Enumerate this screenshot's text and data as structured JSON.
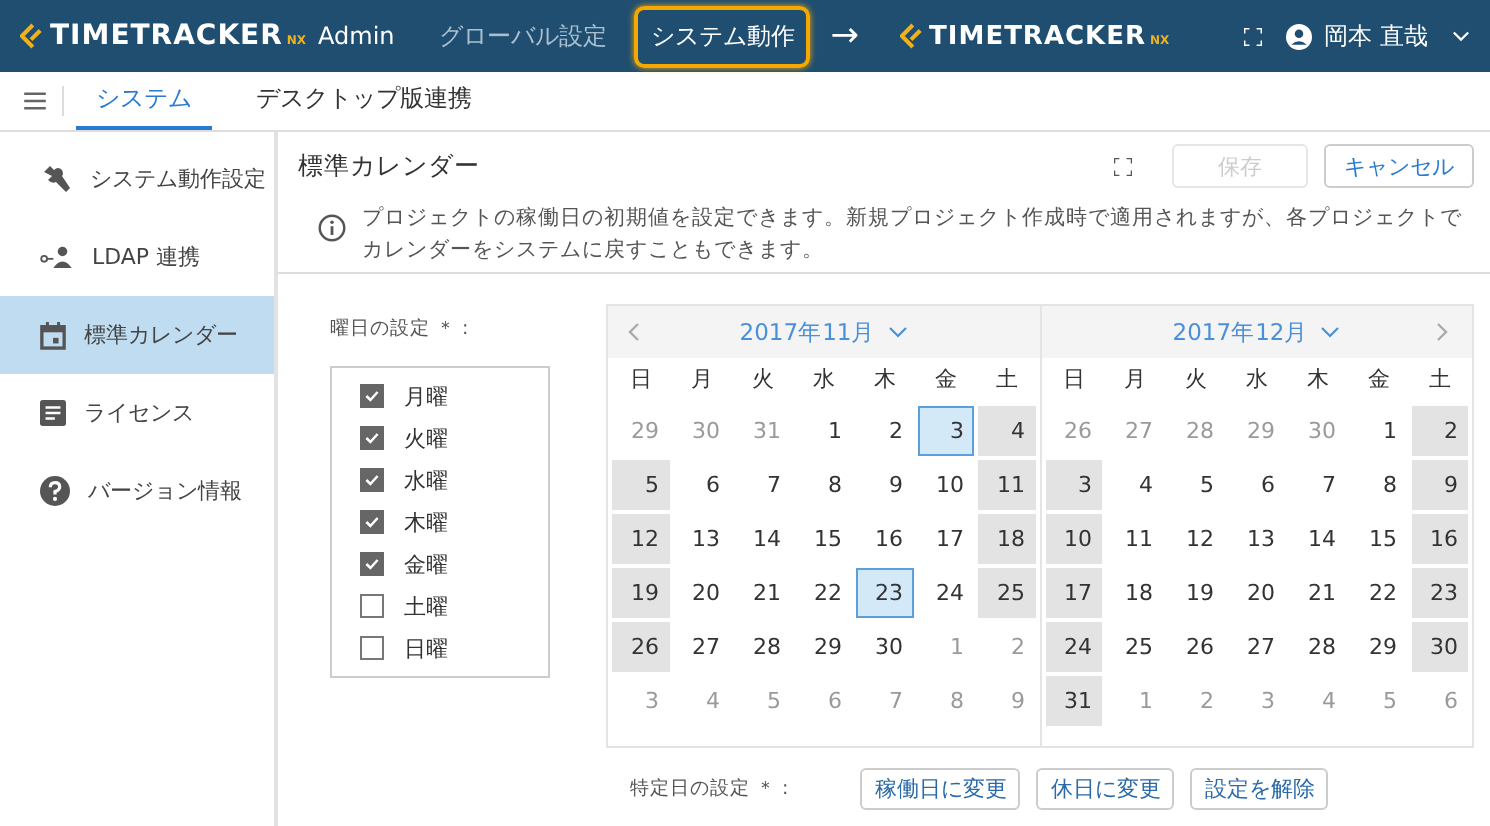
{
  "header": {
    "logo": {
      "name": "TIMETRACKER",
      "suffix": "NX",
      "product": "Admin"
    },
    "nav": [
      {
        "label": "グローバル設定",
        "selected": false
      },
      {
        "label": "システム動作",
        "selected": true
      }
    ],
    "arrow": "→",
    "target_logo": {
      "name": "TIMETRACKER",
      "suffix": "NX"
    },
    "user": "岡本 直哉"
  },
  "tabs": [
    {
      "label": "システム",
      "selected": true
    },
    {
      "label": "デスクトップ版連携",
      "selected": false
    }
  ],
  "sidebar": {
    "items": [
      {
        "kind": "wrench",
        "label": "システム動作設定",
        "selected": false
      },
      {
        "kind": "ldap",
        "label": "LDAP 連携",
        "selected": false
      },
      {
        "kind": "calendar",
        "label": "標準カレンダー",
        "selected": true
      },
      {
        "kind": "license",
        "label": "ライセンス",
        "selected": false
      },
      {
        "kind": "help",
        "label": "バージョン情報",
        "selected": false
      }
    ]
  },
  "panel": {
    "title": "標準カレンダー",
    "buttons": [
      {
        "label": "保存",
        "disabled": true
      },
      {
        "label": "キャンセル",
        "disabled": false
      }
    ],
    "info": "プロジェクトの稼働日の初期値を設定できます。新規プロジェクト作成時で適用されますが、各プロジェクトでカレンダーをシステムに戻すこともできます。",
    "weekday_label": "曜日の設定 ＊ :",
    "weekdays": [
      {
        "label": "月曜",
        "checked": true
      },
      {
        "label": "火曜",
        "checked": true
      },
      {
        "label": "水曜",
        "checked": true
      },
      {
        "label": "木曜",
        "checked": true
      },
      {
        "label": "金曜",
        "checked": true
      },
      {
        "label": "土曜",
        "checked": false
      },
      {
        "label": "日曜",
        "checked": false
      }
    ],
    "months": [
      {
        "title": "2017年11月",
        "prev": true,
        "next": false,
        "day_names": [
          "日",
          "月",
          "火",
          "水",
          "木",
          "金",
          "土"
        ],
        "weeks": [
          [
            {
              "d": "29",
              "outside": true,
              "holiday": false,
              "selected": false
            },
            {
              "d": "30",
              "outside": true,
              "holiday": false,
              "selected": false
            },
            {
              "d": "31",
              "outside": true,
              "holiday": false,
              "selected": false
            },
            {
              "d": "1",
              "outside": false,
              "holiday": false,
              "selected": false
            },
            {
              "d": "2",
              "outside": false,
              "holiday": false,
              "selected": false
            },
            {
              "d": "3",
              "outside": false,
              "holiday": false,
              "selected": true
            },
            {
              "d": "4",
              "outside": false,
              "holiday": true,
              "selected": false
            }
          ],
          [
            {
              "d": "5",
              "outside": false,
              "holiday": true,
              "selected": false
            },
            {
              "d": "6",
              "outside": false,
              "holiday": false,
              "selected": false
            },
            {
              "d": "7",
              "outside": false,
              "holiday": false,
              "selected": false
            },
            {
              "d": "8",
              "outside": false,
              "holiday": false,
              "selected": false
            },
            {
              "d": "9",
              "outside": false,
              "holiday": false,
              "selected": false
            },
            {
              "d": "10",
              "outside": false,
              "holiday": false,
              "selected": false
            },
            {
              "d": "11",
              "outside": false,
              "holiday": true,
              "selected": false
            }
          ],
          [
            {
              "d": "12",
              "outside": false,
              "holiday": true,
              "selected": false
            },
            {
              "d": "13",
              "outside": false,
              "holiday": false,
              "selected": false
            },
            {
              "d": "14",
              "outside": false,
              "holiday": false,
              "selected": false
            },
            {
              "d": "15",
              "outside": false,
              "holiday": false,
              "selected": false
            },
            {
              "d": "16",
              "outside": false,
              "holiday": false,
              "selected": false
            },
            {
              "d": "17",
              "outside": false,
              "holiday": false,
              "selected": false
            },
            {
              "d": "18",
              "outside": false,
              "holiday": true,
              "selected": false
            }
          ],
          [
            {
              "d": "19",
              "outside": false,
              "holiday": true,
              "selected": false
            },
            {
              "d": "20",
              "outside": false,
              "holiday": false,
              "selected": false
            },
            {
              "d": "21",
              "outside": false,
              "holiday": false,
              "selected": false
            },
            {
              "d": "22",
              "outside": false,
              "holiday": false,
              "selected": false
            },
            {
              "d": "23",
              "outside": false,
              "holiday": false,
              "selected": true
            },
            {
              "d": "24",
              "outside": false,
              "holiday": false,
              "selected": false
            },
            {
              "d": "25",
              "outside": false,
              "holiday": true,
              "selected": false
            }
          ],
          [
            {
              "d": "26",
              "outside": false,
              "holiday": true,
              "selected": false
            },
            {
              "d": "27",
              "outside": false,
              "holiday": false,
              "selected": false
            },
            {
              "d": "28",
              "outside": false,
              "holiday": false,
              "selected": false
            },
            {
              "d": "29",
              "outside": false,
              "holiday": false,
              "selected": false
            },
            {
              "d": "30",
              "outside": false,
              "holiday": false,
              "selected": false
            },
            {
              "d": "1",
              "outside": true,
              "holiday": false,
              "selected": false
            },
            {
              "d": "2",
              "outside": true,
              "holiday": false,
              "selected": false
            }
          ],
          [
            {
              "d": "3",
              "outside": true,
              "holiday": false,
              "selected": false
            },
            {
              "d": "4",
              "outside": true,
              "holiday": false,
              "selected": false
            },
            {
              "d": "5",
              "outside": true,
              "holiday": false,
              "selected": false
            },
            {
              "d": "6",
              "outside": true,
              "holiday": false,
              "selected": false
            },
            {
              "d": "7",
              "outside": true,
              "holiday": false,
              "selected": false
            },
            {
              "d": "8",
              "outside": true,
              "holiday": false,
              "selected": false
            },
            {
              "d": "9",
              "outside": true,
              "holiday": false,
              "selected": false
            }
          ]
        ]
      },
      {
        "title": "2017年12月",
        "prev": false,
        "next": true,
        "day_names": [
          "日",
          "月",
          "火",
          "水",
          "木",
          "金",
          "土"
        ],
        "weeks": [
          [
            {
              "d": "26",
              "outside": true,
              "holiday": false,
              "selected": false
            },
            {
              "d": "27",
              "outside": true,
              "holiday": false,
              "selected": false
            },
            {
              "d": "28",
              "outside": true,
              "holiday": false,
              "selected": false
            },
            {
              "d": "29",
              "outside": true,
              "holiday": false,
              "selected": false
            },
            {
              "d": "30",
              "outside": true,
              "holiday": false,
              "selected": false
            },
            {
              "d": "1",
              "outside": false,
              "holiday": false,
              "selected": false
            },
            {
              "d": "2",
              "outside": false,
              "holiday": true,
              "selected": false
            }
          ],
          [
            {
              "d": "3",
              "outside": false,
              "holiday": true,
              "selected": false
            },
            {
              "d": "4",
              "outside": false,
              "holiday": false,
              "selected": false
            },
            {
              "d": "5",
              "outside": false,
              "holiday": false,
              "selected": false
            },
            {
              "d": "6",
              "outside": false,
              "holiday": false,
              "selected": false
            },
            {
              "d": "7",
              "outside": false,
              "holiday": false,
              "selected": false
            },
            {
              "d": "8",
              "outside": false,
              "holiday": false,
              "selected": false
            },
            {
              "d": "9",
              "outside": false,
              "holiday": true,
              "selected": false
            }
          ],
          [
            {
              "d": "10",
              "outside": false,
              "holiday": true,
              "selected": false
            },
            {
              "d": "11",
              "outside": false,
              "holiday": false,
              "selected": false
            },
            {
              "d": "12",
              "outside": false,
              "holiday": false,
              "selected": false
            },
            {
              "d": "13",
              "outside": false,
              "holiday": false,
              "selected": false
            },
            {
              "d": "14",
              "outside": false,
              "holiday": false,
              "selected": false
            },
            {
              "d": "15",
              "outside": false,
              "holiday": false,
              "selected": false
            },
            {
              "d": "16",
              "outside": false,
              "holiday": true,
              "selected": false
            }
          ],
          [
            {
              "d": "17",
              "outside": false,
              "holiday": true,
              "selected": false
            },
            {
              "d": "18",
              "outside": false,
              "holiday": false,
              "selected": false
            },
            {
              "d": "19",
              "outside": false,
              "holiday": false,
              "selected": false
            },
            {
              "d": "20",
              "outside": false,
              "holiday": false,
              "selected": false
            },
            {
              "d": "21",
              "outside": false,
              "holiday": false,
              "selected": false
            },
            {
              "d": "22",
              "outside": false,
              "holiday": false,
              "selected": false
            },
            {
              "d": "23",
              "outside": false,
              "holiday": true,
              "selected": false
            }
          ],
          [
            {
              "d": "24",
              "outside": false,
              "holiday": true,
              "selected": false
            },
            {
              "d": "25",
              "outside": false,
              "holiday": false,
              "selected": false
            },
            {
              "d": "26",
              "outside": false,
              "holiday": false,
              "selected": false
            },
            {
              "d": "27",
              "outside": false,
              "holiday": false,
              "selected": false
            },
            {
              "d": "28",
              "outside": false,
              "holiday": false,
              "selected": false
            },
            {
              "d": "29",
              "outside": false,
              "holiday": false,
              "selected": false
            },
            {
              "d": "30",
              "outside": false,
              "holiday": true,
              "selected": false
            }
          ],
          [
            {
              "d": "31",
              "outside": false,
              "holiday": true,
              "selected": false
            },
            {
              "d": "1",
              "outside": true,
              "holiday": false,
              "selected": false
            },
            {
              "d": "2",
              "outside": true,
              "holiday": false,
              "selected": false
            },
            {
              "d": "3",
              "outside": true,
              "holiday": false,
              "selected": false
            },
            {
              "d": "4",
              "outside": true,
              "holiday": false,
              "selected": false
            },
            {
              "d": "5",
              "outside": true,
              "holiday": false,
              "selected": false
            },
            {
              "d": "6",
              "outside": true,
              "holiday": false,
              "selected": false
            }
          ]
        ]
      }
    ],
    "specific_label": "特定日の設定 ＊ :",
    "specific_buttons": [
      "稼働日に変更",
      "休日に変更",
      "設定を解除"
    ]
  }
}
